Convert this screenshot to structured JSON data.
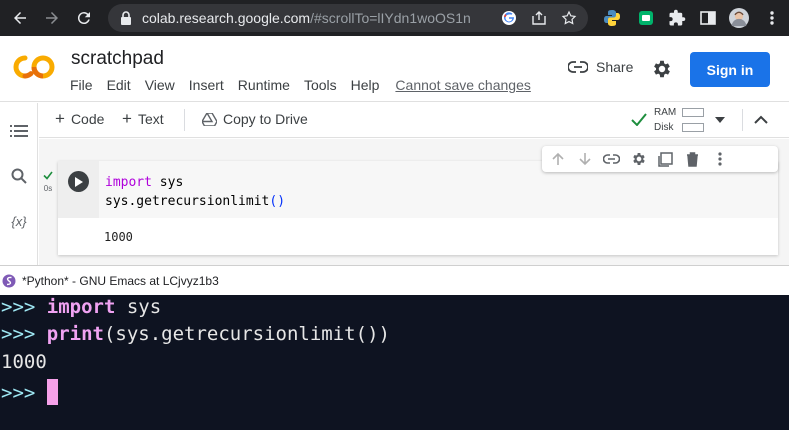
{
  "browser": {
    "url_host": "colab.research.google.com",
    "url_path": "/#scrollTo=lIYdn1woOS1n"
  },
  "colab": {
    "title": "scratchpad",
    "menu": [
      "File",
      "Edit",
      "View",
      "Insert",
      "Runtime",
      "Tools",
      "Help"
    ],
    "save_warning": "Cannot save changes",
    "share_label": "Share",
    "signin_label": "Sign in"
  },
  "toolbar": {
    "code_label": "Code",
    "text_label": "Text",
    "copy_label": "Copy to Drive",
    "ram_label": "RAM",
    "disk_label": "Disk"
  },
  "sidebar": {
    "variables_label": "{x}"
  },
  "cell": {
    "exec_time": "0s",
    "code_line1_kw": "import",
    "code_line1_rest": " sys",
    "code_line2": "sys.getrecursionlimit",
    "code_line2_parens": "()",
    "output": "1000"
  },
  "emacs": {
    "title": "*Python* - GNU Emacs at LCjvyz1b3",
    "prompt": ">>> ",
    "line1_kw": "import",
    "line1_rest": " sys",
    "line2_kw": "print",
    "line2_rest": "(sys.getrecursionlimit())",
    "line3": "1000"
  },
  "colors": {
    "accent_blue": "#1a73e8",
    "colab_orange": "#f9ab00",
    "terminal_bg": "#0e1321",
    "cursor_pink": "#f6a1e9"
  }
}
